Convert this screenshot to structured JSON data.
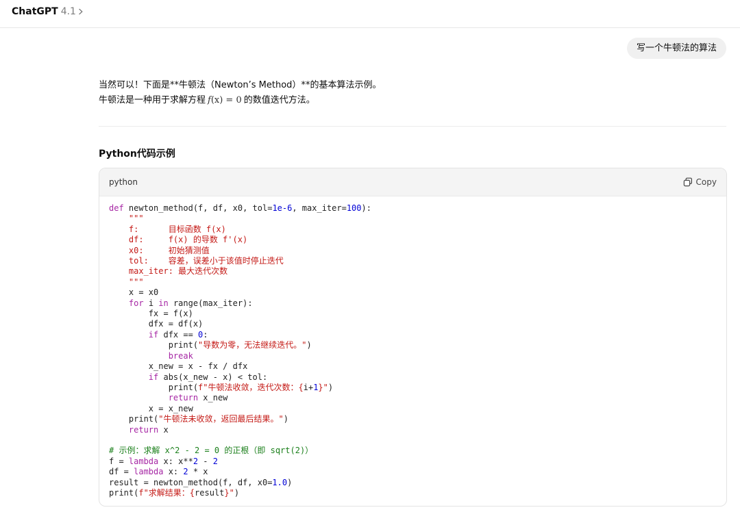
{
  "header": {
    "model_name": "ChatGPT",
    "model_version": "4.1",
    "chevron_icon": "chevron-right-icon"
  },
  "user_message": "写一个牛顿法的算法",
  "assistant": {
    "intro_line1": "当然可以！下面是**牛顿法（Newton’s Method）**的基本算法示例。",
    "intro_line2_before": "牛顿法是一种用于求解方程",
    "intro_line2_math_f": "f",
    "intro_line2_math_rest": "(x) = 0",
    "intro_line2_after": "的数值迭代方法。",
    "section_title": "Python代码示例"
  },
  "code_block": {
    "language": "python",
    "copy_label": "Copy",
    "copy_icon": "copy-icon",
    "lines": [
      [
        [
          "kw",
          "def"
        ],
        [
          "t",
          " newton_method(f, df, x0, tol="
        ],
        [
          "num",
          "1e-6"
        ],
        [
          "t",
          ", max_iter="
        ],
        [
          "num",
          "100"
        ],
        [
          "t",
          "):"
        ]
      ],
      [
        [
          "str",
          "    \"\"\""
        ]
      ],
      [
        [
          "str",
          "    f:      目标函数 f(x)"
        ]
      ],
      [
        [
          "str",
          "    df:     f(x) 的导数 f'(x)"
        ]
      ],
      [
        [
          "str",
          "    x0:     初始猜测值"
        ]
      ],
      [
        [
          "str",
          "    tol:    容差，误差小于该值时停止迭代"
        ]
      ],
      [
        [
          "str",
          "    max_iter: 最大迭代次数"
        ]
      ],
      [
        [
          "str",
          "    \"\"\""
        ]
      ],
      [
        [
          "t",
          "    x = x0"
        ]
      ],
      [
        [
          "t",
          "    "
        ],
        [
          "kw",
          "for"
        ],
        [
          "t",
          " i "
        ],
        [
          "kw",
          "in"
        ],
        [
          "t",
          " range(max_iter):"
        ]
      ],
      [
        [
          "t",
          "        fx = f(x)"
        ]
      ],
      [
        [
          "t",
          "        dfx = df(x)"
        ]
      ],
      [
        [
          "t",
          "        "
        ],
        [
          "kw",
          "if"
        ],
        [
          "t",
          " dfx == "
        ],
        [
          "num",
          "0"
        ],
        [
          "t",
          ":"
        ]
      ],
      [
        [
          "t",
          "            print("
        ],
        [
          "str",
          "\"导数为零，无法继续迭代。\""
        ],
        [
          "t",
          ")"
        ]
      ],
      [
        [
          "t",
          "            "
        ],
        [
          "kw",
          "break"
        ]
      ],
      [
        [
          "t",
          "        x_new = x - fx / dfx"
        ]
      ],
      [
        [
          "t",
          "        "
        ],
        [
          "kw",
          "if"
        ],
        [
          "t",
          " abs(x_new - x) < tol:"
        ]
      ],
      [
        [
          "t",
          "            print("
        ],
        [
          "str",
          "f\"牛顿法收敛，迭代次数：{"
        ],
        [
          "t",
          "i+"
        ],
        [
          "num",
          "1"
        ],
        [
          "str",
          "}\""
        ],
        [
          "t",
          ")"
        ]
      ],
      [
        [
          "t",
          "            "
        ],
        [
          "kw",
          "return"
        ],
        [
          "t",
          " x_new"
        ]
      ],
      [
        [
          "t",
          "        x = x_new"
        ]
      ],
      [
        [
          "t",
          "    print("
        ],
        [
          "str",
          "\"牛顿法未收敛，返回最后结果。\""
        ],
        [
          "t",
          ")"
        ]
      ],
      [
        [
          "t",
          "    "
        ],
        [
          "kw",
          "return"
        ],
        [
          "t",
          " x"
        ]
      ],
      [
        [
          "t",
          ""
        ]
      ],
      [
        [
          "cmt",
          "# 示例：求解 x^2 - 2 = 0 的正根（即 sqrt(2)）"
        ]
      ],
      [
        [
          "t",
          "f = "
        ],
        [
          "kw",
          "lambda"
        ],
        [
          "t",
          " x: x**"
        ],
        [
          "num",
          "2"
        ],
        [
          "t",
          " - "
        ],
        [
          "num",
          "2"
        ]
      ],
      [
        [
          "t",
          "df = "
        ],
        [
          "kw",
          "lambda"
        ],
        [
          "t",
          " x: "
        ],
        [
          "num",
          "2"
        ],
        [
          "t",
          " * x"
        ]
      ],
      [
        [
          "t",
          "result = newton_method(f, df, x0="
        ],
        [
          "num",
          "1.0"
        ],
        [
          "t",
          ")"
        ]
      ],
      [
        [
          "t",
          "print("
        ],
        [
          "str",
          "f\"求解结果：{"
        ],
        [
          "t",
          "result"
        ],
        [
          "str",
          "}\""
        ],
        [
          "t",
          ")"
        ]
      ]
    ]
  }
}
